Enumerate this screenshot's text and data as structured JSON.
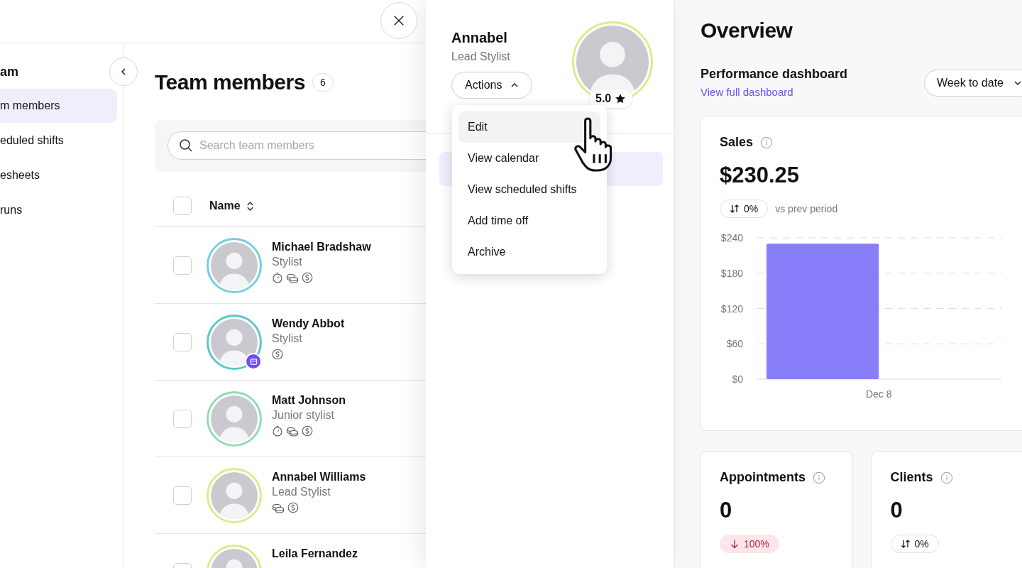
{
  "sidebar": {
    "title": "am",
    "items": [
      {
        "label": "m members",
        "selected": true
      },
      {
        "label": "eduled shifts",
        "selected": false
      },
      {
        "label": "esheets",
        "selected": false
      },
      {
        "label": "runs",
        "selected": false
      }
    ]
  },
  "main": {
    "title": "Team members",
    "count": "6",
    "search": {
      "placeholder": "Search team members"
    },
    "table": {
      "header_checked": false,
      "columns": [
        {
          "label": "Name"
        }
      ],
      "rows": [
        {
          "name": "Michael Bradshaw",
          "role": "Stylist",
          "color": "#74cfe0",
          "checked": false,
          "badge": false,
          "icons": [
            {
              "kind": "timer"
            },
            {
              "kind": "coins"
            },
            {
              "kind": "dollar"
            }
          ]
        },
        {
          "name": "Wendy Abbot",
          "role": "Stylist",
          "color": "#5cc8c8",
          "checked": false,
          "badge": true,
          "icons": [
            {
              "kind": "dollar"
            }
          ]
        },
        {
          "name": "Matt Johnson",
          "role": "Junior stylist",
          "color": "#93dcb0",
          "checked": false,
          "badge": false,
          "icons": [
            {
              "kind": "timer"
            },
            {
              "kind": "coins"
            },
            {
              "kind": "dollar"
            }
          ]
        },
        {
          "name": "Annabel Williams",
          "role": "Lead Stylist",
          "color": "#e2e88a",
          "checked": false,
          "badge": false,
          "icons": [
            {
              "kind": "coins"
            },
            {
              "kind": "dollar"
            }
          ]
        },
        {
          "name": "Leila Fernandez",
          "color": "#e2e88a",
          "checked": false,
          "badge": false,
          "icons": []
        }
      ]
    }
  },
  "detail": {
    "name": "Annabel",
    "role": "Lead Stylist",
    "color": "#e2e88a",
    "rating": "5.0",
    "actions": {
      "label": "Actions",
      "expanded": true
    },
    "menu": [
      {
        "label": "Edit",
        "selected": true
      },
      {
        "label": "View calendar",
        "selected": false
      },
      {
        "label": "View scheduled shifts",
        "selected": false
      },
      {
        "label": "Add time off",
        "selected": false
      },
      {
        "label": "Archive",
        "selected": false
      }
    ]
  },
  "overview": {
    "title": "Overview",
    "dashboard": {
      "title": "Performance dashboard",
      "link": "View full dashboard",
      "period": "Week to date"
    },
    "sales": {
      "title": "Sales",
      "value": "$230.25",
      "change": {
        "text": "0%",
        "kind": "flat"
      },
      "comparison": "vs prev period",
      "chart_data": {
        "type": "bar",
        "categories": [
          "Dec 8"
        ],
        "series": [
          {
            "color": "#887ef9",
            "values": [
              230
            ]
          }
        ],
        "ylim": [
          0,
          240
        ],
        "grid": true,
        "yticks": [
          {
            "value": 0,
            "label": "$0"
          },
          {
            "value": 60,
            "label": "$60"
          },
          {
            "value": 120,
            "label": "$120"
          },
          {
            "value": 180,
            "label": "$180"
          },
          {
            "value": 240,
            "label": "$240"
          }
        ]
      }
    },
    "metrics": [
      {
        "title": "Appointments",
        "value": "0",
        "change": {
          "text": "100%",
          "kind": "down"
        }
      },
      {
        "title": "Clients",
        "value": "0",
        "change": {
          "text": "0%",
          "kind": "flat"
        }
      }
    ]
  }
}
